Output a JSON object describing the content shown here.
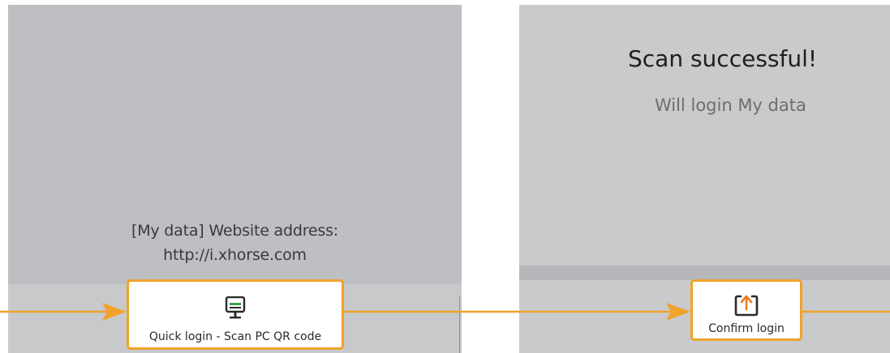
{
  "left_screen": {
    "address_line_1": "[My data] Website address:",
    "address_line_2": "http://i.xhorse.com",
    "quick_login_button": {
      "label": "Quick login - Scan PC QR code",
      "icon": "desktop-monitor-icon"
    }
  },
  "right_screen": {
    "title": "Scan successful!",
    "subtitle": "Will login My data",
    "confirm_login_button": {
      "label": "Confirm login",
      "icon": "upload-arrow-icon"
    }
  },
  "colors": {
    "highlight": "#f0a22a",
    "screen_background": "#c4c6c8"
  }
}
